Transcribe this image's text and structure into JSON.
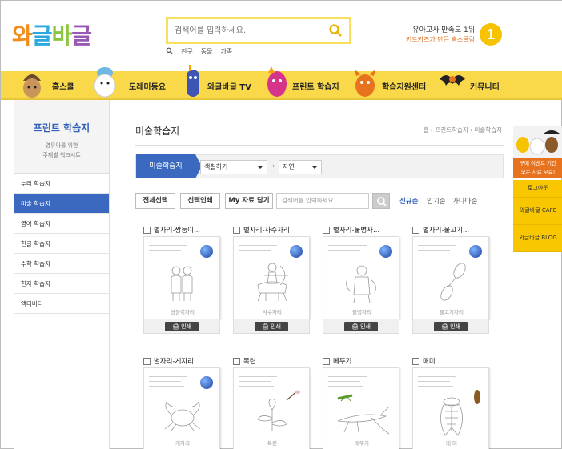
{
  "header": {
    "logo_text": [
      "와",
      "글",
      "바",
      "글"
    ],
    "search_placeholder": "검색어를 입력하세요.",
    "quick_links": [
      "친구",
      "동물",
      "가족"
    ],
    "promo_line1": "유아교사 만족도 1위",
    "promo_line2": "키드키즈가 만든 홈스쿨링",
    "promo_badge": "1"
  },
  "nav": {
    "items": [
      {
        "label": "홈스쿨"
      },
      {
        "label": "도레미동요"
      },
      {
        "label": "와글바글 TV"
      },
      {
        "label": "프린트 학습지"
      },
      {
        "label": "학습지원센터"
      },
      {
        "label": "커뮤니티"
      }
    ]
  },
  "sidebar": {
    "title": "프린트 학습지",
    "subtitle_line1": "영유아를 위한",
    "subtitle_line2": "주제별 워크시트",
    "items": [
      {
        "label": "누리 학습지",
        "active": false
      },
      {
        "label": "미술 학습지",
        "active": true
      },
      {
        "label": "영어 학습지",
        "active": false
      },
      {
        "label": "한글 학습지",
        "active": false
      },
      {
        "label": "수학 학습지",
        "active": false
      },
      {
        "label": "한자 학습지",
        "active": false
      },
      {
        "label": "액티비티",
        "active": false
      }
    ]
  },
  "main": {
    "page_title": "미술학습지",
    "breadcrumb": "홈 › 프린트학습지 › 미술학습지",
    "filter_tab": "미술학습지",
    "select_type": "색칠하기",
    "select_topic": "자연",
    "btn_select_all": "전체선택",
    "btn_print_selected": "선택인쇄",
    "btn_my_materials": "My 자료 담기",
    "search_placeholder": "검색어를 입력하세요.",
    "sort": [
      "신규순",
      "인기순",
      "가나다순"
    ],
    "print_label": "인쇄",
    "cards": [
      {
        "title": "별자리-쌍둥이...",
        "caption": "쌍둥이자리"
      },
      {
        "title": "별자리-사수자리",
        "caption": "사수자리"
      },
      {
        "title": "별자리-물병자...",
        "caption": "물병자리"
      },
      {
        "title": "별자리-물고기...",
        "caption": "물고기자리"
      },
      {
        "title": "별자리-게자리",
        "caption": "게자리"
      },
      {
        "title": "목련",
        "caption": "목련"
      },
      {
        "title": "메뚜기",
        "caption": "메뚜기"
      },
      {
        "title": "매미",
        "caption": "매 미"
      }
    ]
  },
  "float": {
    "promo_line1": "구매 이벤트 기간",
    "promo_line2": "모든 자료 무료!",
    "links": [
      "로그아웃",
      "와글바글 CAFE",
      "와글바글 BLOG"
    ]
  },
  "colors": {
    "nav_bg": "#f9d94a",
    "accent_blue": "#3a69bf",
    "search_border": "#f6e05e",
    "float_bg": "#f9c700"
  }
}
